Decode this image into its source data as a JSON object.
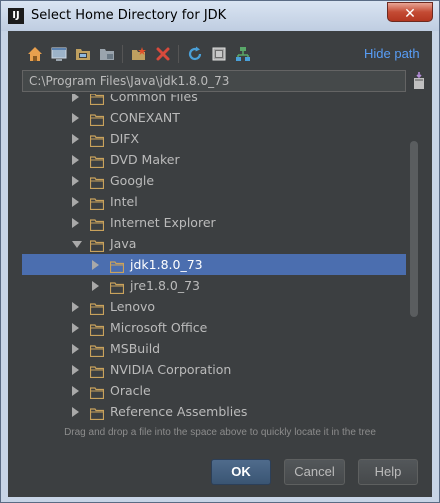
{
  "window": {
    "title": "Select Home Directory for JDK",
    "app_icon_text": "IJ",
    "close_glyph": "✕"
  },
  "toolbar": {
    "icons": [
      "home-icon",
      "desktop-icon",
      "project-folder-icon",
      "module-folder-icon",
      "new-folder-icon",
      "delete-icon",
      "refresh-icon",
      "show-hidden-icon",
      "tree-icon"
    ],
    "hide_path_label": "Hide path"
  },
  "path_field": {
    "value": "C:\\Program Files\\Java\\jdk1.8.0_73"
  },
  "tree": {
    "items": [
      {
        "label": "Common Files",
        "expanded": false
      },
      {
        "label": "CONEXANT",
        "expanded": false
      },
      {
        "label": "DIFX",
        "expanded": false
      },
      {
        "label": "DVD Maker",
        "expanded": false
      },
      {
        "label": "Google",
        "expanded": false
      },
      {
        "label": "Intel",
        "expanded": false
      },
      {
        "label": "Internet Explorer",
        "expanded": false
      },
      {
        "label": "Java",
        "expanded": true
      },
      {
        "label": "jdk1.8.0_73",
        "expanded": false,
        "selected": true
      },
      {
        "label": "jre1.8.0_73",
        "expanded": false
      },
      {
        "label": "Lenovo",
        "expanded": false
      },
      {
        "label": "Microsoft Office",
        "expanded": false
      },
      {
        "label": "MSBuild",
        "expanded": false
      },
      {
        "label": "NVIDIA Corporation",
        "expanded": false
      },
      {
        "label": "Oracle",
        "expanded": false
      },
      {
        "label": "Reference Assemblies",
        "expanded": false
      }
    ]
  },
  "hint": "Drag and drop a file into the space above to quickly locate it in the tree",
  "buttons": {
    "ok": "OK",
    "cancel": "Cancel",
    "help": "Help"
  },
  "colors": {
    "selection": "#4b6eaf",
    "link": "#589df6",
    "folder": "#c9a25c",
    "background": "#3c3f41"
  }
}
